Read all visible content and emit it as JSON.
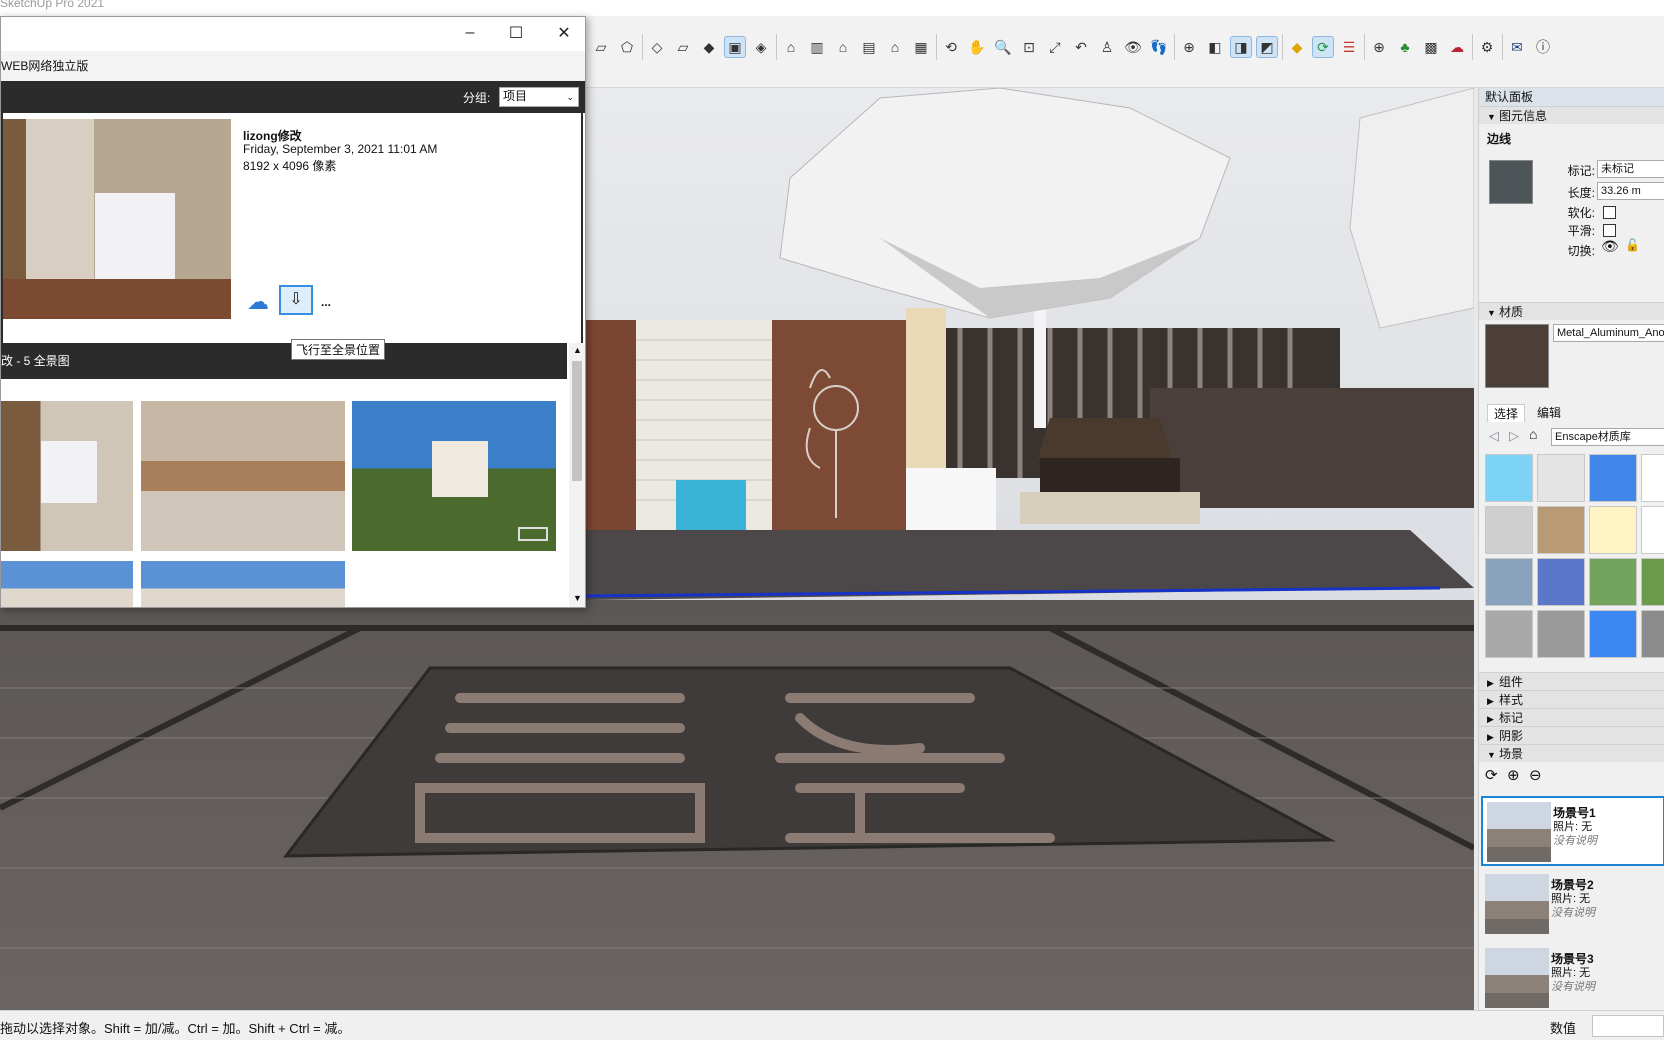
{
  "app": {
    "title": "SketchUp Pro 2021"
  },
  "dialog": {
    "subtitle": "WEB网络独立版",
    "group_label": "分组:",
    "group_value": "项目",
    "pano": {
      "name": "lizong修改",
      "date": "Friday, September 3, 2021 11:01 AM",
      "size": "8192 x 4096 像素"
    },
    "more": "...",
    "tooltip": "飞行至全景位置",
    "gallery_title": "改 - 5 全景图"
  },
  "panel": {
    "title": "默认面板",
    "entity_info": {
      "section": "图元信息",
      "type": "边线",
      "tag_label": "标记:",
      "tag_value": "未标记",
      "length_label": "长度:",
      "length_value": "33.26 m",
      "soften_label": "软化:",
      "smooth_label": "平滑:",
      "toggle_label": "切换:"
    },
    "materials": {
      "section": "材质",
      "name": "Metal_Aluminum_Anodized",
      "tab_select": "选择",
      "tab_edit": "编辑",
      "library": "Enscape材质库",
      "swatches": [
        "#7dd3f5",
        "#e4e4e4",
        "#3f86e8",
        "#ffffff",
        "#cfcfcf",
        "#b89b74",
        "#fff3c4",
        "#ffffff",
        "#8aa3bd",
        "#5b77c9",
        "#74a35e",
        "#6a9a4a",
        "#a9a9a9",
        "#9a9a9a",
        "#3c86f0",
        "#8c8c8c"
      ]
    },
    "collapsed": [
      "组件",
      "样式",
      "标记",
      "阴影"
    ],
    "scenes": {
      "section": "场景",
      "items": [
        {
          "name": "场景号1",
          "photo": "照片: 无",
          "desc": "没有说明"
        },
        {
          "name": "场景号2",
          "photo": "照片: 无",
          "desc": "没有说明"
        },
        {
          "name": "场景号3",
          "photo": "照片: 无",
          "desc": "没有说明"
        }
      ]
    }
  },
  "status": {
    "hint": "拖动以选择对象。Shift = 加/减。Ctrl = 加。Shift + Ctrl = 减。",
    "measure_label": "数值"
  },
  "colors": {
    "accent": "#1c84d4",
    "dark_header": "#2b2b2b"
  }
}
